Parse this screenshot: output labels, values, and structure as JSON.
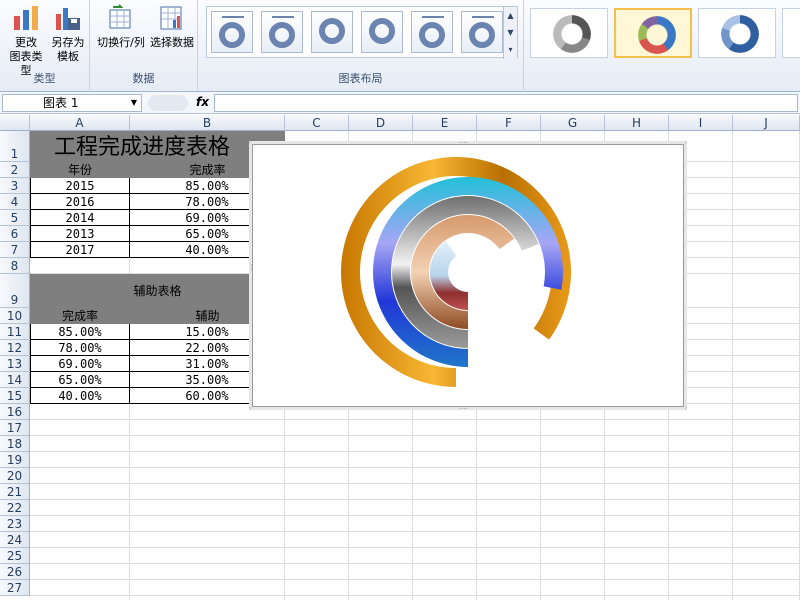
{
  "ribbon": {
    "groups": [
      {
        "label": "类型",
        "buttons": [
          "更改\n图表类型",
          "另存为\n模板"
        ]
      },
      {
        "label": "数据",
        "buttons": [
          "切换行/列",
          "选择数据"
        ]
      },
      {
        "label": "图表布局"
      }
    ],
    "change_type_l1": "更改",
    "change_type_l2": "图表类型",
    "save_template_l1": "另存为",
    "save_template_l2": "模板",
    "switch_rowcol": "切换行/列",
    "select_data": "选择数据",
    "group_type": "类型",
    "group_data": "数据",
    "group_layout": "图表布局"
  },
  "formula_bar": {
    "name_box": "图表 1",
    "fx": "fx",
    "formula": ""
  },
  "columns": [
    "A",
    "B",
    "C",
    "D",
    "E",
    "F",
    "G",
    "H",
    "I",
    "J"
  ],
  "rows": [
    "1",
    "2",
    "3",
    "4",
    "5",
    "6",
    "7",
    "8",
    "9",
    "10",
    "11",
    "12",
    "13",
    "14",
    "15",
    "16",
    "17",
    "18",
    "19",
    "20",
    "21",
    "22",
    "23",
    "24",
    "25",
    "26",
    "27"
  ],
  "table1": {
    "title": "工程完成进度表格",
    "headers": [
      "年份",
      "完成率"
    ],
    "rows": [
      [
        "2015",
        "85.00%"
      ],
      [
        "2016",
        "78.00%"
      ],
      [
        "2014",
        "69.00%"
      ],
      [
        "2013",
        "65.00%"
      ],
      [
        "2017",
        "40.00%"
      ]
    ]
  },
  "table2": {
    "title": "辅助表格",
    "headers": [
      "完成率",
      "辅助"
    ],
    "rows": [
      [
        "85.00%",
        "15.00%"
      ],
      [
        "78.00%",
        "22.00%"
      ],
      [
        "69.00%",
        "31.00%"
      ],
      [
        "65.00%",
        "35.00%"
      ],
      [
        "40.00%",
        "60.00%"
      ]
    ]
  },
  "colors": {
    "ring_gold": "#e0940a",
    "ring_blue": "#2f6fd6",
    "ring_cyan": "#22b8d8",
    "ring_silver": "#8e8e8e",
    "ring_copper": "#b8683d",
    "ring_red": "#a63a3a",
    "accent": "#f2c14e"
  },
  "chart_data": {
    "type": "doughnut",
    "categories": [
      "2015",
      "2016",
      "2014",
      "2013",
      "2017"
    ],
    "series": [
      {
        "values": [
          85,
          15
        ]
      },
      {
        "values": [
          78,
          22
        ]
      },
      {
        "values": [
          69,
          31
        ]
      },
      {
        "values": [
          65,
          35
        ]
      },
      {
        "values": [
          40,
          60
        ]
      }
    ],
    "title": "",
    "legend": "none"
  }
}
